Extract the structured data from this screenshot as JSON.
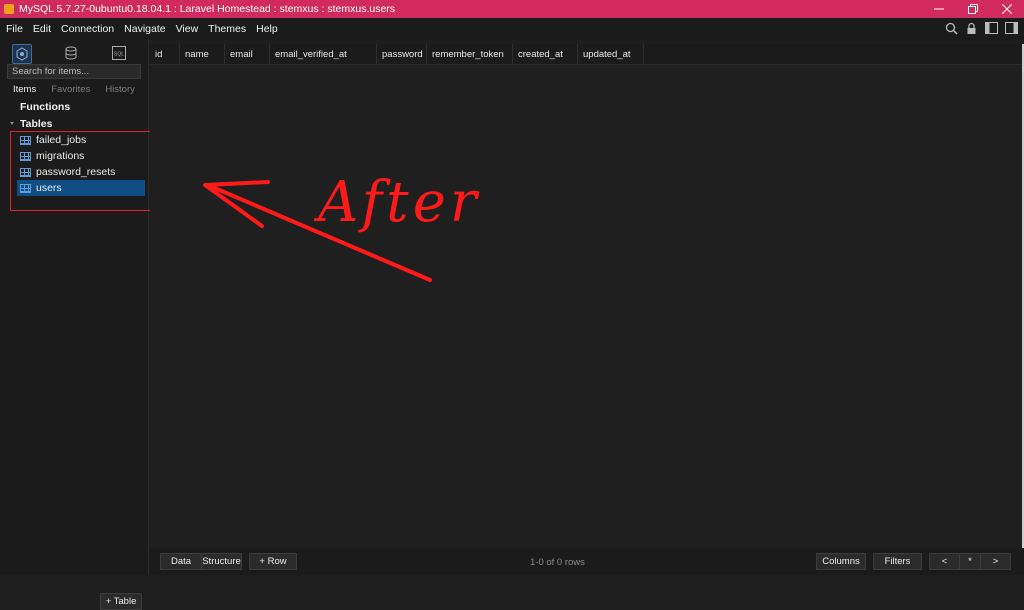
{
  "window": {
    "title": "MySQL 5.7.27-0ubuntu0.18.04.1 : Laravel Homestead : stemxus : stemxus.users",
    "controls": [
      "minimize",
      "restore",
      "close"
    ]
  },
  "menu": [
    "File",
    "Edit",
    "Connection",
    "Navigate",
    "View",
    "Themes",
    "Help"
  ],
  "sidebar": {
    "search_placeholder": "Search for items...",
    "tabs": [
      "Items",
      "Favorites",
      "History"
    ],
    "functions_label": "Functions",
    "tables_label": "Tables",
    "tables": [
      "failed_jobs",
      "migrations",
      "password_resets",
      "users"
    ],
    "selected_table": "users",
    "add_table_label": "+ Table",
    "sql_icon_label": "SQL"
  },
  "grid": {
    "columns": [
      "id",
      "name",
      "email",
      "email_verified_at",
      "password",
      "remember_token",
      "created_at",
      "updated_at"
    ]
  },
  "footer": {
    "data_label": "Data",
    "structure_label": "Structure",
    "add_row_label": "+ Row",
    "row_count": "1-0 of 0 rows",
    "columns_label": "Columns",
    "filters_label": "Filters",
    "prev_label": "<",
    "all_label": "*",
    "next_label": ">"
  },
  "annotation": {
    "text": "After",
    "color": "#ff1a1a"
  },
  "colors": {
    "titlebar": "#d02a5f",
    "selection": "#0e4e84",
    "table_icon": "#5c9ed8"
  }
}
